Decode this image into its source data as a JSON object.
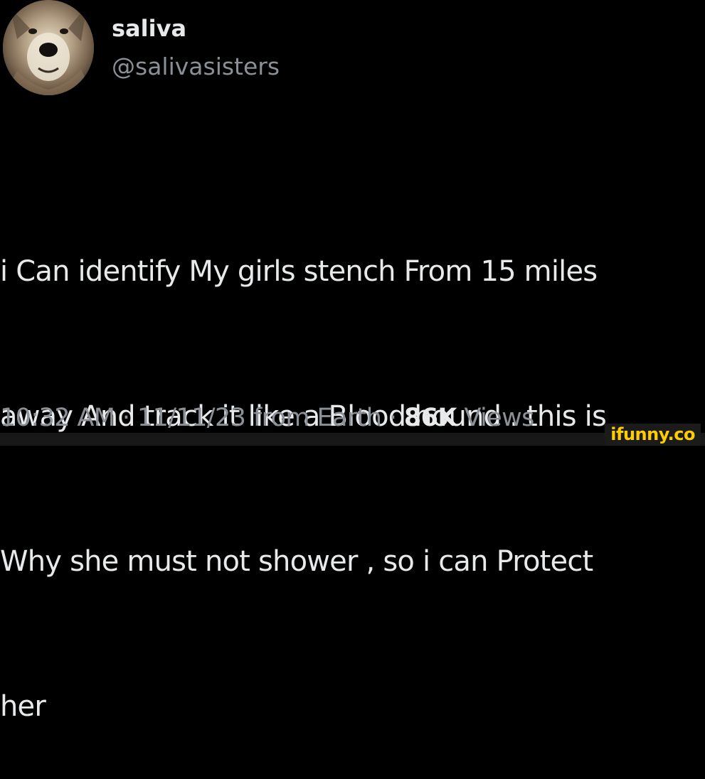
{
  "author": {
    "display_name": "saliva",
    "handle": "@salivasisters",
    "avatar_icon": "wolf-avatar-icon"
  },
  "tweet": {
    "lines": [
      "i Can  identify My girls stench From 15 miles",
      "away And track it like a Blood hound . this is",
      "Why she must not shower , so i can Protect",
      "her"
    ]
  },
  "meta": {
    "time": "10:32 AM",
    "separator": "·",
    "date": "11/11/23",
    "source": "from Earth",
    "views_count": "86K",
    "views_label": "Views"
  },
  "watermark": {
    "text": "ifunny.co"
  },
  "colors": {
    "background": "#000000",
    "primary_text": "#e7e9ea",
    "secondary_text": "#8b9096",
    "watermark": "#ffcc00"
  }
}
